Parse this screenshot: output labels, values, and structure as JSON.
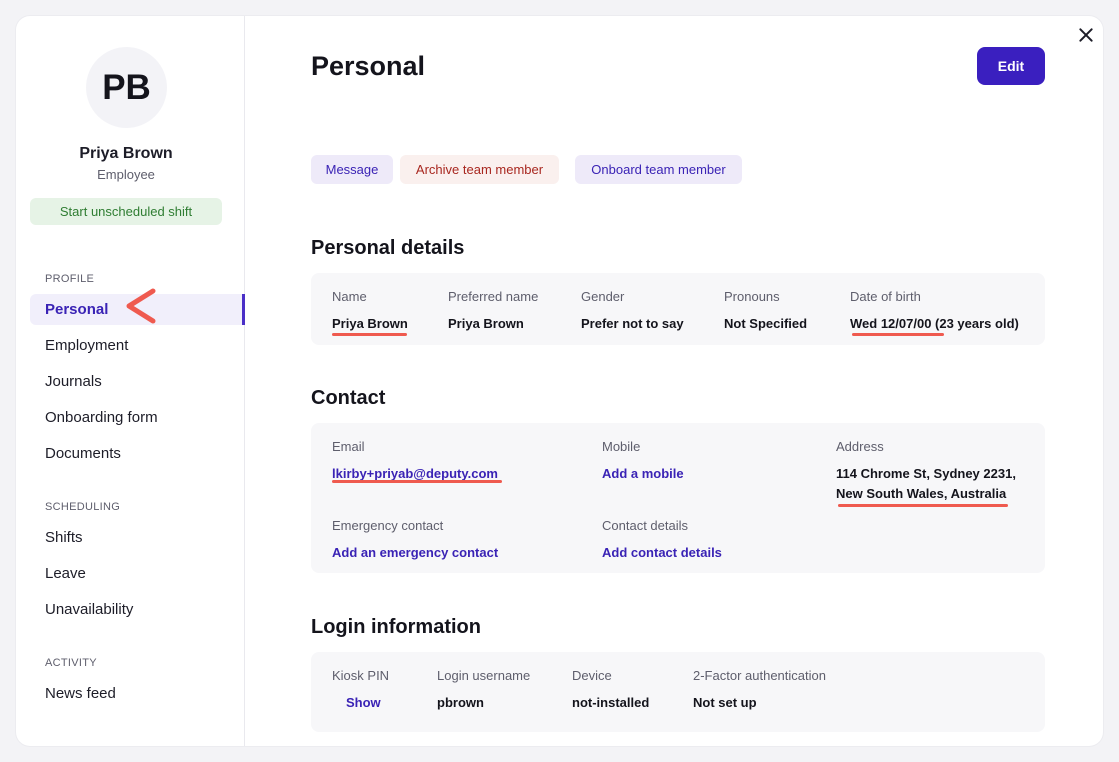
{
  "sidebar": {
    "avatar_initials": "PB",
    "user_name": "Priya Brown",
    "user_role": "Employee",
    "start_shift_label": "Start unscheduled shift",
    "sections": [
      {
        "heading": "PROFILE",
        "items": [
          "Personal",
          "Employment",
          "Journals",
          "Onboarding form",
          "Documents"
        ]
      },
      {
        "heading": "SCHEDULING",
        "items": [
          "Shifts",
          "Leave",
          "Unavailability"
        ]
      },
      {
        "heading": "ACTIVITY",
        "items": [
          "News feed"
        ]
      }
    ],
    "active_item": "Personal"
  },
  "header": {
    "title": "Personal",
    "edit_label": "Edit"
  },
  "actions": {
    "message": "Message",
    "archive": "Archive team member",
    "onboard": "Onboard team member"
  },
  "personal_details": {
    "title": "Personal details",
    "fields": [
      {
        "label": "Name",
        "value": "Priya Brown"
      },
      {
        "label": "Preferred name",
        "value": "Priya Brown"
      },
      {
        "label": "Gender",
        "value": "Prefer not to say"
      },
      {
        "label": "Pronouns",
        "value": "Not Specified"
      },
      {
        "label": "Date of birth",
        "value": "Wed 12/07/00 (23 years old)"
      }
    ]
  },
  "contact": {
    "title": "Contact",
    "email_label": "Email",
    "email_value": "lkirby+priyab@deputy.com",
    "mobile_label": "Mobile",
    "mobile_link": "Add a mobile",
    "address_label": "Address",
    "address_line1": "114 Chrome St, Sydney 2231,",
    "address_line2": "New South Wales, Australia",
    "emergency_label": "Emergency contact",
    "emergency_link": "Add an emergency contact",
    "contact_details_label": "Contact details",
    "contact_details_link": "Add contact details"
  },
  "login": {
    "title": "Login information",
    "kiosk_label": "Kiosk PIN",
    "kiosk_action": "Show",
    "username_label": "Login username",
    "username_value": "pbrown",
    "device_label": "Device",
    "device_value": "not-installed",
    "twofa_label": "2-Factor authentication",
    "twofa_value": "Not set up"
  },
  "colors": {
    "accent": "#3a1fbf",
    "annotation": "#ef5a4f",
    "success_bg": "#e6f3e6",
    "danger_text": "#a8271f"
  },
  "icons": {
    "close": "close-icon",
    "annotation": "chevron-left-icon"
  }
}
